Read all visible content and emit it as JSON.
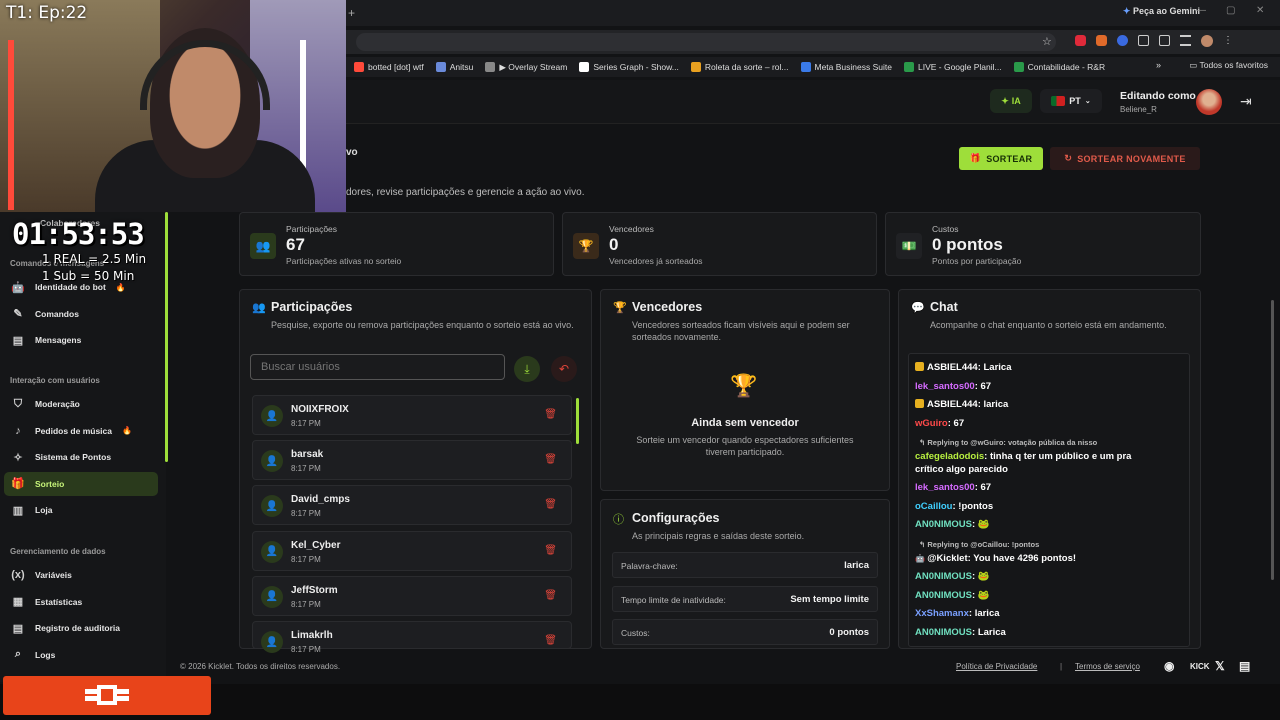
{
  "browser": {
    "gemini_label": "Peça ao Gemini",
    "bookmarks": [
      {
        "label": "botted [dot] wtf",
        "color": "#ff4a3a"
      },
      {
        "label": "Anitsu",
        "color": "#6a8ada"
      },
      {
        "label": "▶ Overlay Stream",
        "color": "#888888"
      },
      {
        "label": "Series Graph - Show...",
        "color": "#ffffff"
      },
      {
        "label": "Roleta da sorte – rol...",
        "color": "#e8a020"
      },
      {
        "label": "Meta Business Suite",
        "color": "#3a7ae8"
      },
      {
        "label": "LIVE - Google Planil...",
        "color": "#2a9a4a"
      },
      {
        "label": "Contabilidade - R&R",
        "color": "#2a9a4a"
      }
    ],
    "bookmarks_folder": "Todos os favoritos"
  },
  "header": {
    "ia_label": "IA",
    "lang_label": "PT",
    "editing_as": "Editando como",
    "username": "Beliene_R"
  },
  "overlay": {
    "episode": "T1: Ep:22",
    "timer": "01:53:53",
    "rule1": "1 REAL = 2.5 Min",
    "rule2": "1 Sub = 50 Min"
  },
  "sidebar": {
    "partial_top": "Colaboradores",
    "partial_section": "Comandos e mensagens",
    "items_a": [
      {
        "label": "Identidade do bot",
        "icon": "🤖",
        "fire": true
      },
      {
        "label": "Comandos",
        "icon": "✎",
        "fire": false
      },
      {
        "label": "Mensagens",
        "icon": "▤",
        "fire": false
      }
    ],
    "section_interaction": "Interação com usuários",
    "items_b": [
      {
        "label": "Moderação",
        "icon": "⛉",
        "fire": false
      },
      {
        "label": "Pedidos de música",
        "icon": "♪",
        "fire": true
      },
      {
        "label": "Sistema de Pontos",
        "icon": "✧",
        "fire": false
      },
      {
        "label": "Sorteio",
        "icon": "🎁",
        "fire": false,
        "active": true
      },
      {
        "label": "Loja",
        "icon": "▥",
        "fire": false
      }
    ],
    "section_data": "Gerenciamento de dados",
    "items_c": [
      {
        "label": "Variáveis",
        "icon": "(x)"
      },
      {
        "label": "Estatísticas",
        "icon": "▦"
      },
      {
        "label": "Registro de auditoria",
        "icon": "▤"
      },
      {
        "label": "Logs",
        "icon": "⌕"
      }
    ]
  },
  "page": {
    "title_fragment": "vo",
    "description": "dores, revise participações e gerencie a ação ao vivo.",
    "btn_sortear": "SORTEAR",
    "btn_sortear_again": "SORTEAR NOVAMENTE"
  },
  "stats": [
    {
      "label": "Participações",
      "value": "67",
      "sub": "Participações ativas no sorteio",
      "icon": "👥"
    },
    {
      "label": "Vencedores",
      "value": "0",
      "sub": "Vencedores já sorteados",
      "icon": "🏆"
    },
    {
      "label": "Custos",
      "value": "0 pontos",
      "sub": "Pontos por participação",
      "icon": "💵"
    }
  ],
  "participants_card": {
    "title": "Participações",
    "description": "Pesquise, exporte ou remova participações enquanto o sorteio está ao vivo.",
    "search_placeholder": "Buscar usuários",
    "rows": [
      {
        "name": "NOIIXFROIX",
        "time": "8:17 PM"
      },
      {
        "name": "barsak",
        "time": "8:17 PM"
      },
      {
        "name": "David_cmps",
        "time": "8:17 PM"
      },
      {
        "name": "Kel_Cyber",
        "time": "8:17 PM"
      },
      {
        "name": "JeffStorm",
        "time": "8:17 PM"
      },
      {
        "name": "Limakrlh",
        "time": "8:17 PM"
      }
    ]
  },
  "winners_card": {
    "title": "Vencedores",
    "description": "Vencedores sorteados ficam visíveis aqui e podem ser sorteados novamente.",
    "empty_title": "Ainda sem vencedor",
    "empty_desc": "Sorteie um vencedor quando espectadores suficientes tiverem participado."
  },
  "config_card": {
    "title": "Configurações",
    "description": "As principais regras e saídas deste sorteio.",
    "rows": [
      {
        "key": "Palavra-chave:",
        "value": "larica"
      },
      {
        "key": "Tempo limite de inatividade:",
        "value": "Sem tempo limite"
      },
      {
        "key": "Custos:",
        "value": "0 pontos"
      }
    ]
  },
  "chat_card": {
    "title": "Chat",
    "description": "Acompanhe o chat enquanto o sorteio está em andamento.",
    "messages": [
      {
        "type": "msg",
        "badge": true,
        "user": "ASBIEL444",
        "color": "#ffffff",
        "text": "Larica"
      },
      {
        "type": "msg",
        "badge": false,
        "user": "lek_santos00",
        "color": "#d56bff",
        "text": "67"
      },
      {
        "type": "msg",
        "badge": true,
        "user": "ASBIEL444",
        "color": "#ffffff",
        "text": "larica"
      },
      {
        "type": "msg",
        "badge": false,
        "user": "wGuiro",
        "color": "#ff4a4a",
        "text": "67"
      },
      {
        "type": "reply",
        "text": "↰ Replying to @wGuiro: votação pública da nisso"
      },
      {
        "type": "msg",
        "badge": false,
        "user": "cafegeladodois",
        "color": "#b8f040",
        "text": "tinha q ter um público e um pra"
      },
      {
        "type": "cont",
        "text": "crítico algo parecido"
      },
      {
        "type": "msg",
        "badge": false,
        "user": "lek_santos00",
        "color": "#d56bff",
        "text": "67"
      },
      {
        "type": "msg",
        "badge": false,
        "user": "oCaillou",
        "color": "#40d0ff",
        "text": "!pontos"
      },
      {
        "type": "msg",
        "badge": false,
        "user": "AN0NIMOUS",
        "color": "#70e0c0",
        "text": "🐸"
      },
      {
        "type": "reply",
        "text": "↰ Replying to @oCaillou: !pontos"
      },
      {
        "type": "msg",
        "badge": false,
        "user": "@Kicklet",
        "color": "#ffffff",
        "text": "You have 4296 pontos!",
        "bot": true
      },
      {
        "type": "msg",
        "badge": false,
        "user": "AN0NIMOUS",
        "color": "#70e0c0",
        "text": "🐸"
      },
      {
        "type": "msg",
        "badge": false,
        "user": "AN0NIMOUS",
        "color": "#70e0c0",
        "text": "🐸"
      },
      {
        "type": "msg",
        "badge": false,
        "user": "XxShamanx",
        "color": "#7aa0ff",
        "text": "larica"
      },
      {
        "type": "msg",
        "badge": false,
        "user": "AN0NIMOUS",
        "color": "#70e0c0",
        "text": "Larica"
      }
    ]
  },
  "footer": {
    "copyright": "© 2026 Kicklet. Todos os direitos reservados.",
    "privacy": "Política de Privacidade",
    "separator": "|",
    "terms": "Termos de serviço",
    "kick": "KICK"
  },
  "colors": {
    "accent": "#9ede3a",
    "danger": "#e0453a"
  }
}
